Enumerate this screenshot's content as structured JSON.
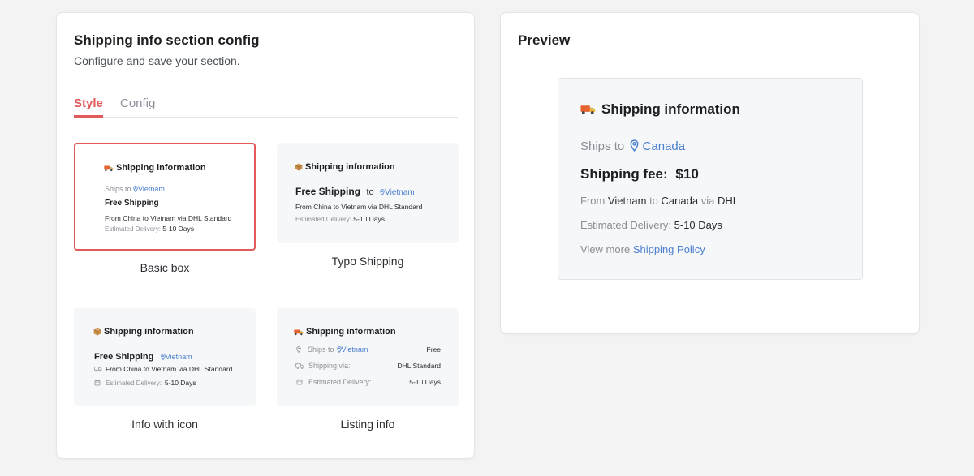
{
  "config": {
    "title": "Shipping info section config",
    "subtitle": "Configure and save your section.",
    "tabs": [
      {
        "label": "Style",
        "active": true
      },
      {
        "label": "Config",
        "active": false
      }
    ],
    "options": [
      {
        "name": "Basic box",
        "selected": true,
        "title": "Shipping information",
        "ships_to": "Ships to",
        "country": "Vietnam",
        "fee": "Free Shipping",
        "from": "From China to Vietnam via DHL Standard",
        "est_label": "Estimated Delivery:",
        "est_value": "5-10 Days"
      },
      {
        "name": "Typo Shipping",
        "selected": false,
        "title": "Shipping information",
        "fee": "Free Shipping",
        "to": "to",
        "country": "Vietnam",
        "from": "From China to Vietnam via DHL Standard",
        "est_label": "Estimated Delivery:",
        "est_value": "5-10 Days"
      },
      {
        "name": "Info with icon",
        "selected": false,
        "title": "Shipping information",
        "fee": "Free Shipping",
        "country": "Vietnam",
        "from": "From China to Vietnam via DHL Standard",
        "est_label": "Estimated Delivery:",
        "est_value": "5-10 Days"
      },
      {
        "name": "Listing info",
        "selected": false,
        "title": "Shipping information",
        "ships_to": "Ships to",
        "country": "Vietnam",
        "ships_to_value": "Free",
        "via_label": "Shipping via:",
        "via_value": "DHL Standard",
        "est_label": "Estimated Delivery:",
        "est_value": "5-10 Days"
      }
    ]
  },
  "preview": {
    "title": "Preview",
    "heading": "Shipping information",
    "ships_to": "Ships to",
    "country": "Canada",
    "fee_label": "Shipping fee:",
    "fee_value": "$10",
    "from_word": "From",
    "origin": "Vietnam",
    "to_word": "to",
    "destination": "Canada",
    "via_word": "via",
    "carrier": "DHL",
    "est_label": "Estimated Delivery:",
    "est_value": "5-10 Days",
    "more_prefix": "View more",
    "more_link": "Shipping Policy"
  },
  "colors": {
    "accent": "#e25a5a",
    "link": "#4a7fd0",
    "background": "#f3f3f4"
  }
}
